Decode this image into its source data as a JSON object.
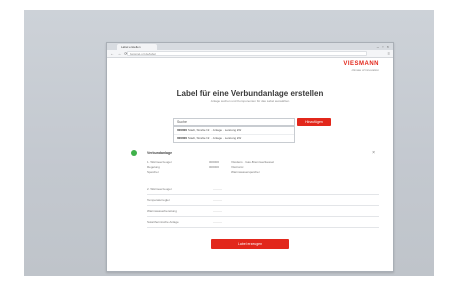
{
  "browser": {
    "tab_title": "Label erstellen",
    "window_controls": "– ▫ ×",
    "nav_icons": "← → ⟳",
    "url": "beispiel-url.de/label",
    "menu_icon": "≡"
  },
  "brand": {
    "logo_text": "VIESMANN",
    "tagline": "climate of innovation"
  },
  "header": {
    "title": "Label für eine Verbundanlage erstellen",
    "subtitle": "Anlage suchen und Komponenten für das Label auswählen"
  },
  "search": {
    "value": "Suche",
    "button_label": "Hinzufügen",
    "results": [
      {
        "id": "000000",
        "text": "Stadt, Straße Nr. · Anlage · Leistung kW"
      },
      {
        "id": "000000",
        "text": "Stadt, Straße Nr. · Anlage · Leistung kW"
      }
    ]
  },
  "entry": {
    "title": "Verbundanlage",
    "close_icon": "×",
    "status_color": "#3fb14a",
    "details": [
      {
        "key": "1. Wärmeerzeuger",
        "code": "000000",
        "value": "Vitodens · Gas-Brennwertkessel"
      },
      {
        "key": "Regelung",
        "code": "000000",
        "value": "Vitotronic"
      },
      {
        "key": "Speicher",
        "code": "",
        "value": "Warmwasserspeicher"
      }
    ],
    "fields": [
      {
        "label": "2. Wärmeerzeuger",
        "value": "———"
      },
      {
        "label": "Temperaturregler",
        "value": "———"
      },
      {
        "label": "Warmwasserbereitung",
        "value": "———"
      },
      {
        "label": "Solarthermische Anlage",
        "value": "———"
      }
    ]
  },
  "submit": {
    "label": "Label erzeugen"
  },
  "colors": {
    "accent": "#e2271b",
    "success": "#3fb14a"
  }
}
